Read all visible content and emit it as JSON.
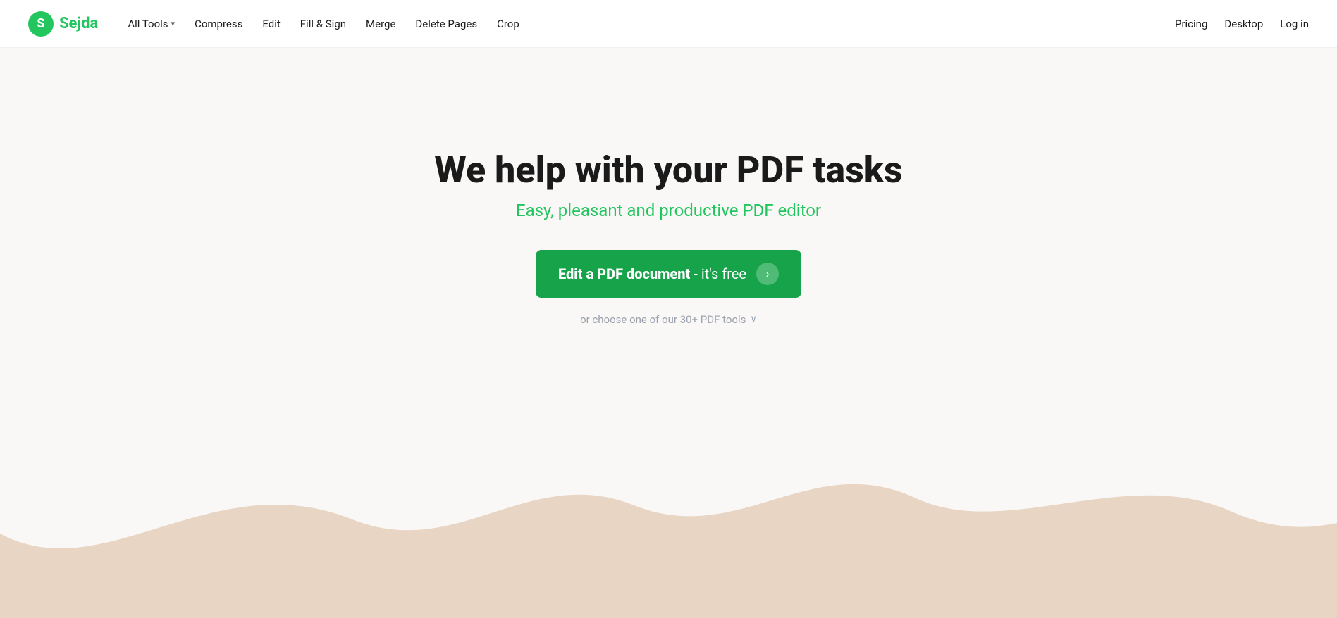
{
  "logo": {
    "icon_letter": "S",
    "text": "Sejda"
  },
  "nav": {
    "links": [
      {
        "label": "All Tools",
        "has_chevron": true
      },
      {
        "label": "Compress",
        "has_chevron": false
      },
      {
        "label": "Edit",
        "has_chevron": false
      },
      {
        "label": "Fill & Sign",
        "has_chevron": false
      },
      {
        "label": "Merge",
        "has_chevron": false
      },
      {
        "label": "Delete Pages",
        "has_chevron": false
      },
      {
        "label": "Crop",
        "has_chevron": false
      }
    ],
    "right_links": [
      {
        "label": "Pricing"
      },
      {
        "label": "Desktop"
      },
      {
        "label": "Log in"
      }
    ]
  },
  "hero": {
    "title": "We help with your PDF tasks",
    "subtitle": "Easy, pleasant and productive PDF editor",
    "cta_bold": "Edit a PDF document",
    "cta_rest": " - it's free",
    "tools_text": "or choose one of our 30+ PDF tools",
    "arrow": "›"
  },
  "wave": {
    "fill_color": "#e8d5c4"
  }
}
